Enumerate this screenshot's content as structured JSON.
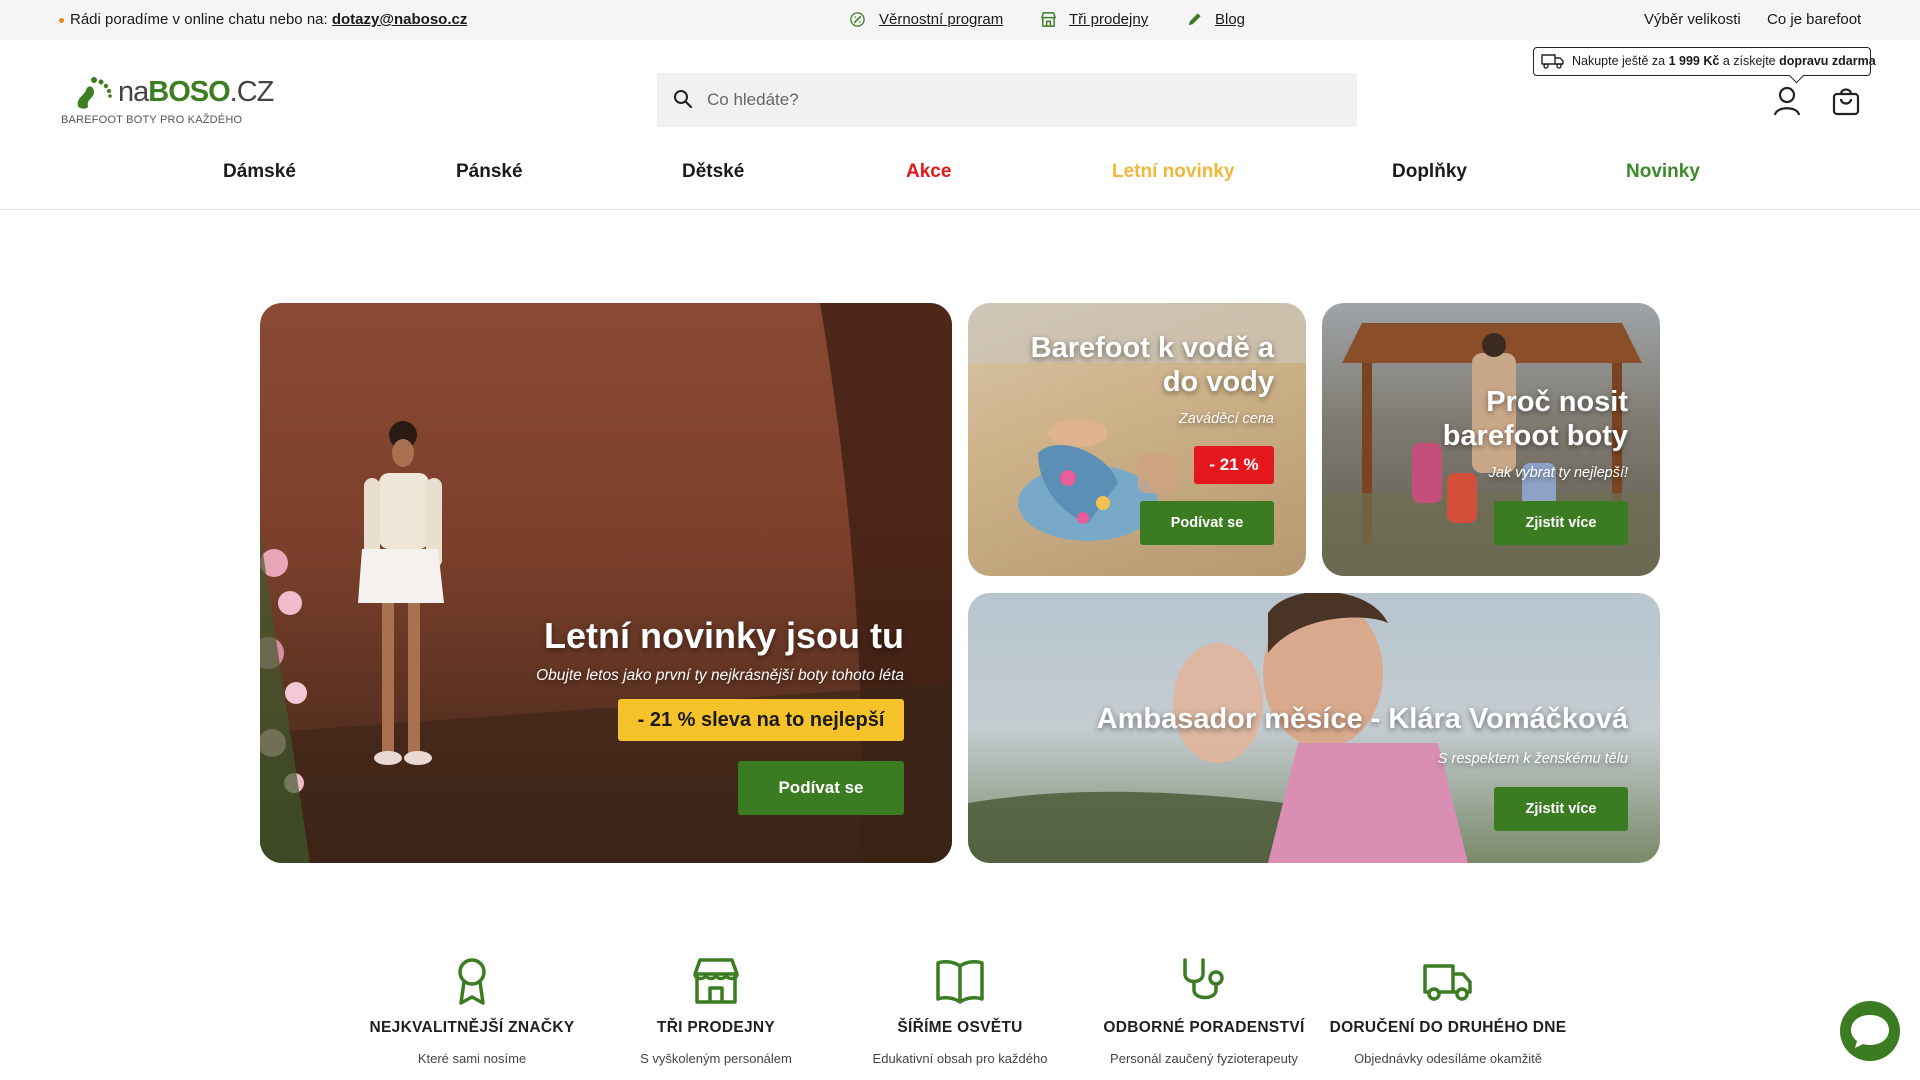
{
  "topbar": {
    "help_text": "Rádi poradíme v online chatu nebo na:",
    "email": "dotazy@naboso.cz",
    "loyalty": "Věrnostní program",
    "stores": "Tři prodejny",
    "blog": "Blog",
    "size_pick": "Výběr velikosti",
    "what_barefoot": "Co je barefoot"
  },
  "header": {
    "logo_name_pre": "na",
    "logo_name_bold": "BOSO",
    "logo_name_post": ".CZ",
    "logo_tagline": "BAREFOOT BOTY PRO KAŽDÉHO",
    "search_placeholder": "Co hledáte?",
    "shipping_pre": "Nakupte ještě za",
    "shipping_amount": "1 999 Kč",
    "shipping_mid": "a získejte",
    "shipping_bold": "dopravu zdarma"
  },
  "nav": {
    "items": [
      "Dámské",
      "Pánské",
      "Dětské",
      "Akce",
      "Letní novinky",
      "Doplňky",
      "Novinky"
    ],
    "colors": {
      "akce": "#e3171c",
      "letni": "#f0b73a",
      "novinky": "#3b8a2a",
      "default": "#1a1a1a"
    }
  },
  "tiles": {
    "main": {
      "title": "Letní novinky jsou tu",
      "subtitle": "Obujte letos jako první ty nejkrásnější boty tohoto léta",
      "badge": "- 21 % sleva na to nejlepší",
      "button": "Podívat se"
    },
    "water": {
      "title_1": "Barefoot k vodě a",
      "title_2": "do vody",
      "subtitle": "Zaváděcí cena",
      "badge": "- 21 %",
      "button": "Podívat se"
    },
    "why": {
      "title_1": "Proč nosit",
      "title_2": "barefoot boty",
      "subtitle": "Jak vybrat ty nejlepší!",
      "button": "Zjistit více"
    },
    "ambassador": {
      "title": "Ambasador měsíce - Klára Vomáčková",
      "subtitle": "S respektem k ženskému tělu",
      "button": "Zjistit více"
    }
  },
  "features": [
    {
      "title": "NEJKVALITNĚJŠÍ ZNAČKY",
      "sub": "Které sami nosíme"
    },
    {
      "title": "TŘI PRODEJNY",
      "sub": "S vyškoleným personálem"
    },
    {
      "title": "ŠÍŘÍME OSVĚTU",
      "sub": "Edukativní obsah pro každého"
    },
    {
      "title": "ODBORNÉ PORADENSTVÍ",
      "sub": "Personál zaučený fyzioterapeuty"
    },
    {
      "title": "DORUČENÍ DO DRUHÉHO DNE",
      "sub": "Objednávky odesíláme okamžitě"
    }
  ],
  "colors": {
    "brand_green": "#3b7c22",
    "badge_yellow": "#f5c22a",
    "badge_red": "#e3171c"
  }
}
